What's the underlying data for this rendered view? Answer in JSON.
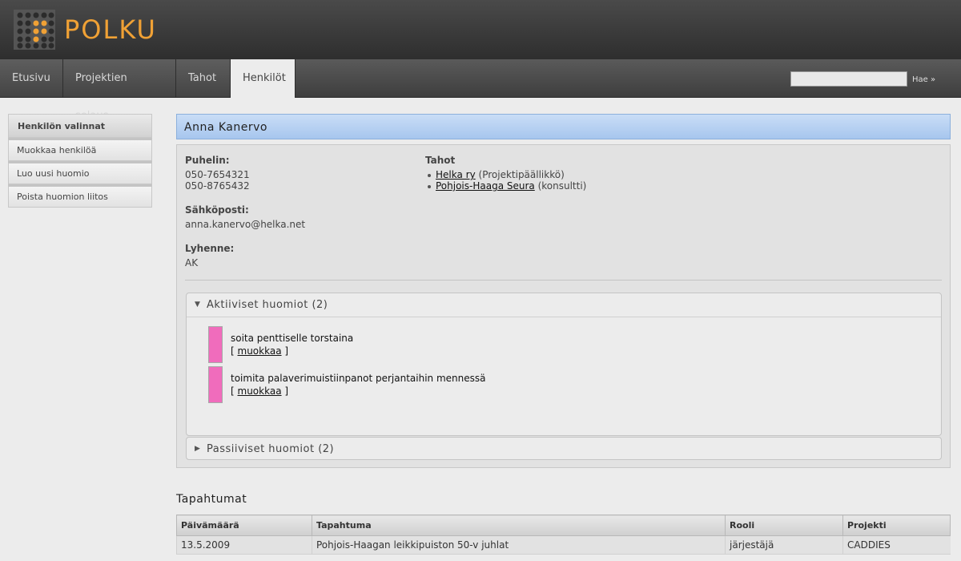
{
  "app": {
    "title": "POLKU"
  },
  "nav": {
    "tabs": [
      {
        "label": "Etusivu"
      },
      {
        "label": "Projektien selaus"
      },
      {
        "label": "Tahot"
      },
      {
        "label": "Henkilöt",
        "active": true
      }
    ],
    "search_value": "",
    "search_button": "Hae »"
  },
  "sidebar": {
    "heading": "Henkilön valinnat",
    "items": [
      {
        "label": "Muokkaa henkilöä"
      },
      {
        "label": "Luo uusi huomio"
      },
      {
        "label": "Poista huomion liitos"
      }
    ]
  },
  "person": {
    "name": "Anna Kanervo",
    "phone_label": "Puhelin:",
    "phones": [
      "050-7654321",
      "050-8765432"
    ],
    "email_label": "Sähköposti:",
    "email": "anna.kanervo@helka.net",
    "abbr_label": "Lyhenne:",
    "abbr": "AK",
    "orgs_label": "Tahot",
    "orgs": [
      {
        "name": "Helka ry",
        "role": "(Projektipäällikkö)"
      },
      {
        "name": "Pohjois-Haaga Seura",
        "role": "(konsultti)"
      }
    ]
  },
  "notes": {
    "active_heading": "Aktiiviset huomiot (2)",
    "passive_heading": "Passiiviset huomiot (2)",
    "active": [
      {
        "text": "soita penttiselle torstaina",
        "edit_label": "muokkaa",
        "color": "#f06cbc"
      },
      {
        "text": "toimita palaverimuistiinpanot perjantaihin mennessä",
        "edit_label": "muokkaa",
        "color": "#f06cbc"
      }
    ],
    "bracket_open": "[",
    "bracket_close": "]"
  },
  "events": {
    "title": "Tapahtumat",
    "columns": [
      "Päivämäärä",
      "Tapahtuma",
      "Rooli",
      "Projekti"
    ],
    "rows": [
      [
        "13.5.2009",
        "Pohjois-Haagan leikkipuiston 50-v juhlat",
        "järjestäjä",
        "CADDIES"
      ]
    ]
  },
  "colors": {
    "accent": "#f0a135",
    "name_bar": "#b5d0f2",
    "note_color": "#f06cbc"
  }
}
